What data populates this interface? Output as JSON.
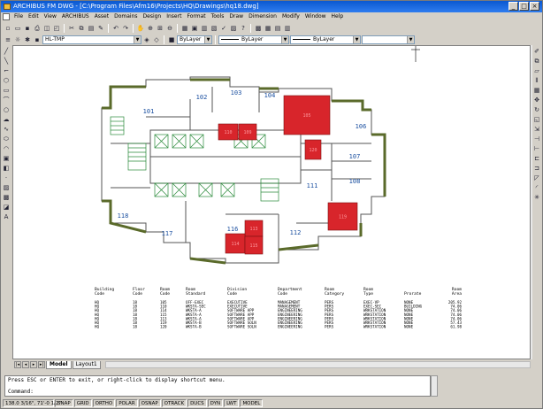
{
  "window": {
    "title": "ARCHIBUS FM DWG - [C:\\Program Files\\Afm16\\Projects\\HQ\\Drawings\\hq18.dwg]",
    "controls": [
      "_",
      "□",
      "×"
    ]
  },
  "menu": [
    "File",
    "Edit",
    "View",
    "ARCHIBUS",
    "Asset",
    "Domains",
    "Design",
    "Insert",
    "Format",
    "Tools",
    "Draw",
    "Dimension",
    "Modify",
    "Window",
    "Help"
  ],
  "toolbar": {
    "layer_combo": "HL-TMP",
    "color_combo": "ByLayer",
    "linetype_combo": "ByLayer",
    "lineweight_combo": "ByLayer"
  },
  "rooms": [
    {
      "num": "101",
      "label_only": true
    },
    {
      "num": "102",
      "label_only": true
    },
    {
      "num": "103",
      "label_only": true
    },
    {
      "num": "104",
      "label_only": true
    },
    {
      "num": "105",
      "color": "#d8252b"
    },
    {
      "num": "106",
      "label_only": true
    },
    {
      "num": "107",
      "label_only": true
    },
    {
      "num": "108",
      "label_only": true
    },
    {
      "num": "109",
      "color": "#d8252b"
    },
    {
      "num": "110",
      "color": "#d8252b"
    },
    {
      "num": "111",
      "label_only": true
    },
    {
      "num": "112",
      "label_only": true
    },
    {
      "num": "113",
      "color": "#d8252b"
    },
    {
      "num": "114",
      "color": "#d8252b"
    },
    {
      "num": "115",
      "color": "#d8252b"
    },
    {
      "num": "116",
      "label_only": true
    },
    {
      "num": "117",
      "label_only": true
    },
    {
      "num": "118",
      "label_only": true
    },
    {
      "num": "119",
      "color": "#d8252b"
    },
    {
      "num": "120",
      "color": "#d8252b"
    }
  ],
  "table": {
    "headers": [
      [
        "Building",
        "Code"
      ],
      [
        "Floor",
        "Code"
      ],
      [
        "Room",
        "Code"
      ],
      [
        "Room",
        "Standard"
      ],
      [
        "Division",
        "Code"
      ],
      [
        "Department",
        "Code"
      ],
      [
        "Room",
        "Category"
      ],
      [
        "Room",
        "Type"
      ],
      [
        "Prorate",
        ""
      ],
      [
        "Room",
        "Area"
      ]
    ],
    "rows": [
      [
        "HQ",
        "18",
        "105",
        "OFF-EXEC",
        "EXECUTIVE",
        "MANAGEMENT",
        "PERS",
        "EXEC-VP",
        "NONE",
        "205.92"
      ],
      [
        "HQ",
        "18",
        "110",
        "WKSTA-SEC",
        "EXECUTIVE",
        "MANAGEMENT",
        "PERS",
        "EXEC-SEC",
        "BUILDING",
        "74.06"
      ],
      [
        "HQ",
        "18",
        "114",
        "WKSTA-A",
        "SOFTWARE APP",
        "ENGINEERING",
        "PERS",
        "WRKSTATION",
        "NONE",
        "74.06"
      ],
      [
        "HQ",
        "18",
        "115",
        "WKSTA-A",
        "SOFTWARE APP",
        "ENGINEERING",
        "PERS",
        "WRKSTATION",
        "NONE",
        "74.06"
      ],
      [
        "HQ",
        "18",
        "113",
        "WKSTA-A",
        "SOFTWARE APP",
        "ENGINEERING",
        "PERS",
        "WRKSTATION",
        "NONE",
        "74.06"
      ],
      [
        "HQ",
        "18",
        "119",
        "WKSTA-B",
        "SOFTWARE SOLN",
        "ENGINEERING",
        "PERS",
        "WRKSTATION",
        "NONE",
        "57.43"
      ],
      [
        "HQ",
        "18",
        "120",
        "WKSTA-B",
        "SOFTWARE SOLN",
        "ENGINEERING",
        "PERS",
        "WRKSTATION",
        "NONE",
        "61.98"
      ]
    ]
  },
  "tabs": [
    "Model",
    "Layout1"
  ],
  "command": {
    "line1": "Press ESC or ENTER to exit, or right-click to display shortcut menu.",
    "line2": "Command:"
  },
  "status": {
    "coords": "138.0 3/16\", 71'-0 1/2\"",
    "toggles": [
      "SNAP",
      "GRID",
      "ORTHO",
      "POLAR",
      "OSNAP",
      "OTRACK",
      "DUCS",
      "DYN",
      "LWT",
      "MODEL"
    ]
  }
}
